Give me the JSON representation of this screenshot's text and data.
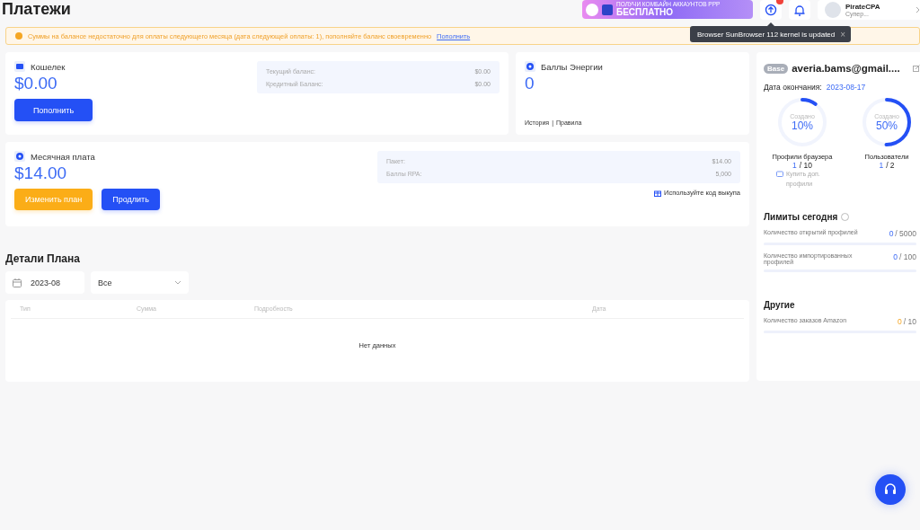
{
  "page_title": "Платежи",
  "header": {
    "banner": {
      "line_1": "ПОЛУЧИ КОМБАЙН АККАУНТОВ PPP",
      "line_2": "БЕСПЛАТНО"
    },
    "update_badge": true,
    "user": {
      "name": "PirateCPA",
      "role": "Супер..."
    }
  },
  "tooltip": {
    "text": "Browser SunBrowser 112 kernel is updated",
    "close": "×"
  },
  "alert": {
    "text": "Суммы на балансе недостаточно для оплаты следующего месяца (дата следующей оплаты: 1), пополняйте баланс своевременно",
    "link": "Пополнить"
  },
  "wallet": {
    "title": "Кошелек",
    "amount": "$0.00",
    "button": "Пополнить",
    "details": [
      {
        "label": "Текущий баланс:",
        "value": "$0.00"
      },
      {
        "label": "Кредитный Баланс:",
        "value": "$0.00"
      }
    ]
  },
  "energy": {
    "title": "Баллы Энергии",
    "amount": "0",
    "links": [
      "История",
      "Правила"
    ],
    "separator": "|"
  },
  "monthly": {
    "title": "Месячная плата",
    "amount": "$14.00",
    "buttons": [
      {
        "label": "Изменить план",
        "kind": "warning"
      },
      {
        "label": "Продлить",
        "kind": "primary"
      }
    ],
    "details": [
      {
        "label": "Пакет:",
        "value": "$14.00"
      },
      {
        "label": "Баллы RPA:",
        "value": "5,000"
      }
    ],
    "redeem": "Используйте код выкупа"
  },
  "plan_details": {
    "title": "Детали Плана",
    "month": "2023-08",
    "filter": "Все",
    "table": {
      "columns": [
        "Тип",
        "Сумма",
        "Подробность",
        "Дата"
      ],
      "empty": "Нет данных"
    }
  },
  "account": {
    "badge": "Base",
    "email": "averia.bams@gmail....",
    "expiry_label": "Дата окончания:",
    "expiry": "2023-08-17",
    "rings": [
      {
        "caption": "Создано",
        "percent": "10%",
        "level": 0.1,
        "label": "Профили браузера",
        "used": "1",
        "total": "/ 10"
      },
      {
        "caption": "Создано",
        "percent": "50%",
        "level": 0.5,
        "label": "Пользователи",
        "used": "1",
        "total": "/ 2"
      }
    ],
    "buy_more": "Купить доп. профили",
    "limits_title": "Лимиты сегодня",
    "limits": [
      {
        "label": "Количество открытий профилей",
        "used": "0",
        "total": "/ 5000"
      },
      {
        "label": "Количество импортированных профилей",
        "used": "0",
        "total": "/ 100"
      }
    ],
    "other_title": "Другие",
    "other": [
      {
        "label": "Количество заказов Amazon",
        "used": "0",
        "total": "/ 10"
      }
    ]
  }
}
